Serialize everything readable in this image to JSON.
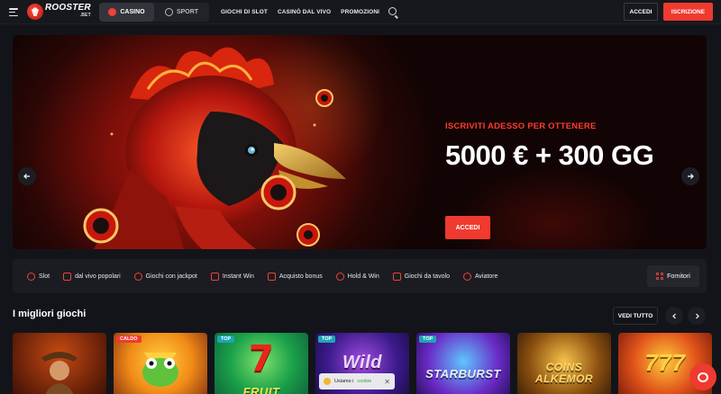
{
  "header": {
    "logo_text": "ROOSTER",
    "logo_sub": ".BET",
    "tabs": [
      {
        "label": "CASINO",
        "icon": "casino-icon",
        "active": true
      },
      {
        "label": "SPORT",
        "icon": "soccer-ball-icon",
        "active": false
      }
    ],
    "nav": [
      "GIOCHI DI SLOT",
      "CASINÒ DAL VIVO",
      "PROMOZIONI"
    ],
    "login_label": "ACCEDI",
    "signup_label": "ISCRIZIONE"
  },
  "hero": {
    "subtitle": "ISCRIVITI ADESSO PER OTTENERE",
    "title": "5000 € + 300 GG",
    "cta_label": "ACCEDI",
    "slides": 4,
    "active_slide": 1
  },
  "categories": [
    {
      "label": "Slot",
      "icon": "cherry-icon"
    },
    {
      "label": "dal vivo popolari",
      "icon": "dealer-icon"
    },
    {
      "label": "Giochi con jackpot",
      "icon": "money-bag-icon"
    },
    {
      "label": "Instant Win",
      "icon": "rocket-icon"
    },
    {
      "label": "Acquisto bonus",
      "icon": "gift-icon"
    },
    {
      "label": "Hold & Win",
      "icon": "coin-icon"
    },
    {
      "label": "Giochi da tavolo",
      "icon": "cards-icon"
    },
    {
      "label": "Aviatore",
      "icon": "plane-icon"
    }
  ],
  "providers_label": "Fornitori",
  "section": {
    "title": "I migliori giochi",
    "see_all_label": "VEDI TUTTO"
  },
  "games": [
    {
      "name": "",
      "tag": ""
    },
    {
      "name": "",
      "tag": "CALDO"
    },
    {
      "name": "FRUIT",
      "tag": "TOP"
    },
    {
      "name": "Wild",
      "tag": "TOP"
    },
    {
      "name": "STARBURST",
      "tag": "TOP"
    },
    {
      "name": "COINS ALKEMOR",
      "tag": ""
    },
    {
      "name": "777",
      "tag": ""
    }
  ],
  "cookie": {
    "text": "Usiamo i",
    "link": "cookie"
  },
  "colors": {
    "accent": "#ef3a2f",
    "background": "#131419",
    "panel": "#1b1c21"
  }
}
